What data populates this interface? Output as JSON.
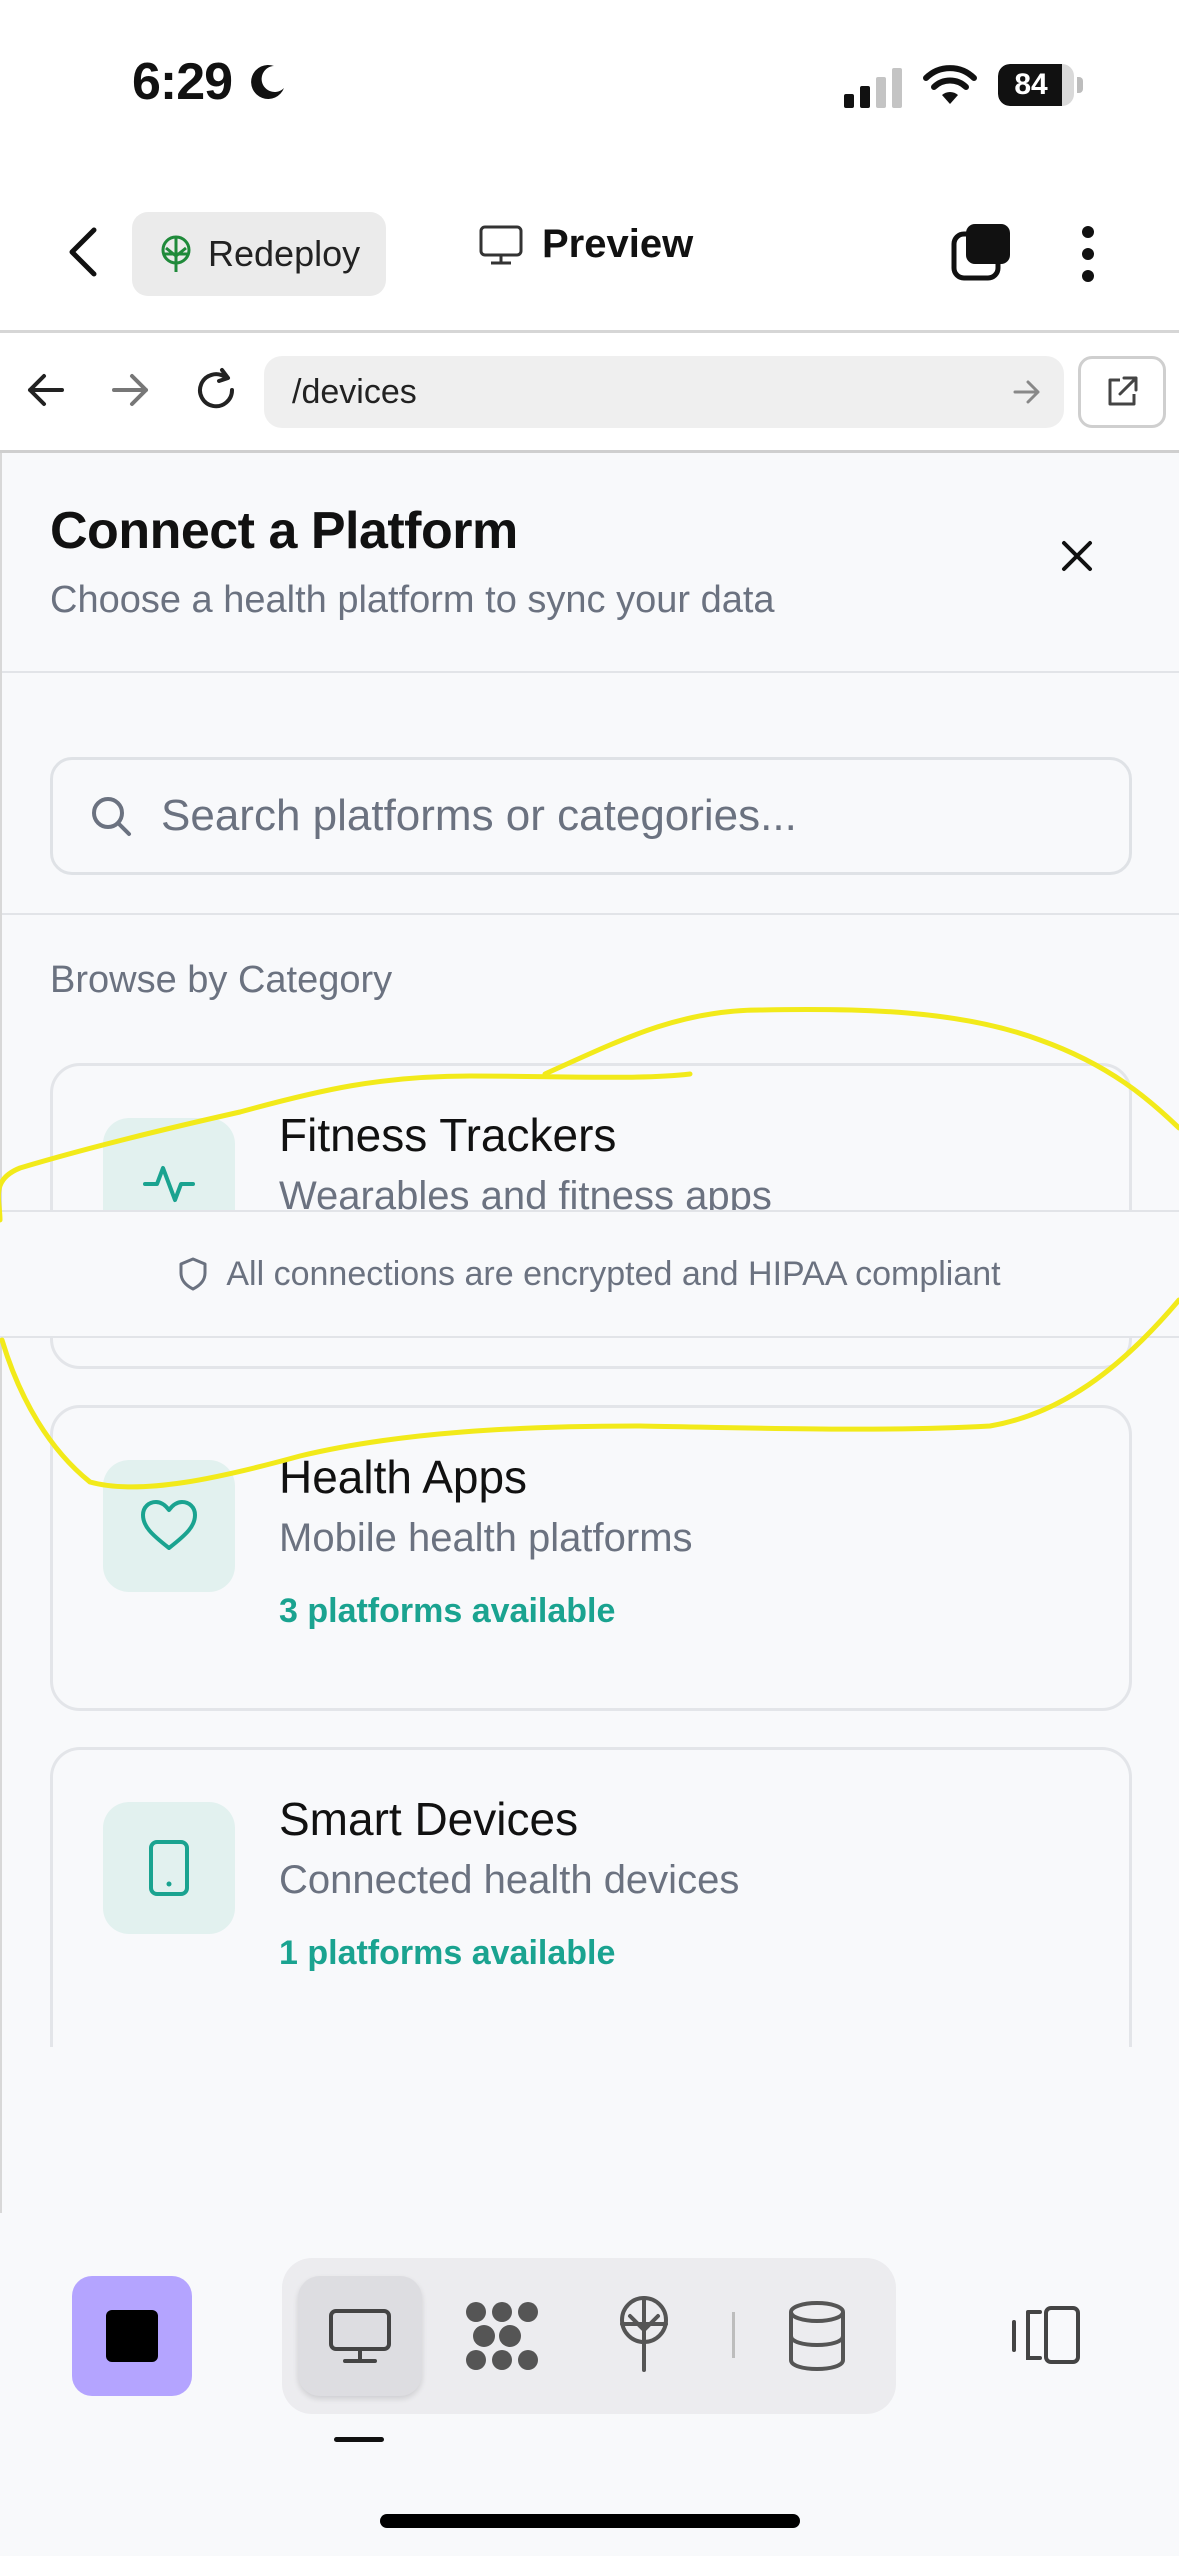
{
  "status_bar": {
    "time": "6:29",
    "battery": "84",
    "battery_level": 0.84
  },
  "header": {
    "redeploy_label": "Redeploy",
    "preview_label": "Preview"
  },
  "browser": {
    "url": "/devices"
  },
  "modal": {
    "title": "Connect a Platform",
    "subtitle": "Choose a health platform to sync your data",
    "search_placeholder": "Search platforms or categories...",
    "browse_label": "Browse by Category",
    "categories": [
      {
        "title": "Fitness Trackers",
        "desc": "Wearables and fitness apps",
        "count": "",
        "icon": "activity-icon"
      },
      {
        "title": "Health Apps",
        "desc": "Mobile health platforms",
        "count": "3 platforms available",
        "icon": "heart-icon"
      },
      {
        "title": "Smart Devices",
        "desc": "Connected health devices",
        "count": "1 platforms available",
        "icon": "tablet-icon"
      }
    ],
    "security_note": "All connections are encrypted and HIPAA compliant"
  },
  "colors": {
    "accent": "#1aa390",
    "stop_button": "#b4a4ff",
    "annotation": "#f2ea1a"
  }
}
